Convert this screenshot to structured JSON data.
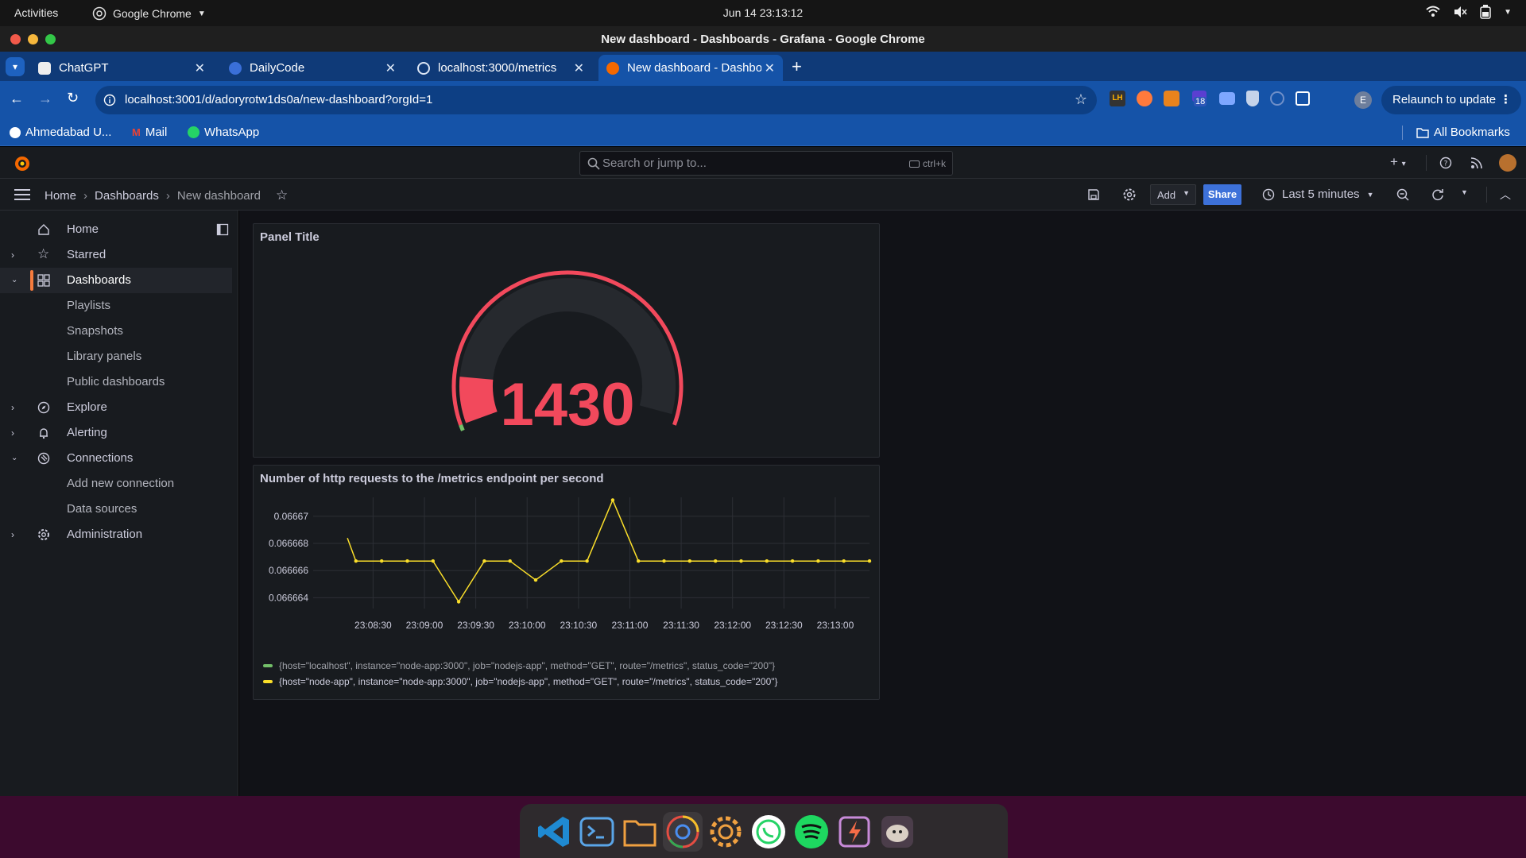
{
  "os": {
    "activities": "Activities",
    "app_name": "Google Chrome",
    "clock": "Jun 14  23:13:12"
  },
  "window": {
    "title": "New dashboard - Dashboards - Grafana - Google Chrome"
  },
  "tabs": [
    {
      "label": "ChatGPT",
      "active": false
    },
    {
      "label": "DailyCode",
      "active": false
    },
    {
      "label": "localhost:3000/metrics",
      "active": false
    },
    {
      "label": "New dashboard - Dashbo",
      "active": true
    }
  ],
  "omnibox": {
    "url": "localhost:3001/d/adoryrotw1ds0a/new-dashboard?orgId=1",
    "relaunch_label": "Relaunch to update",
    "extension_badge": "18",
    "profile_initial": "E"
  },
  "bookmarks": {
    "items": [
      "Ahmedabad U...",
      "Mail",
      "WhatsApp"
    ],
    "all": "All Bookmarks"
  },
  "grafana": {
    "search_placeholder": "Search or jump to...",
    "search_shortcut": "ctrl+k",
    "breadcrumbs": [
      "Home",
      "Dashboards",
      "New dashboard"
    ],
    "toolbar": {
      "add_label": "Add",
      "share_label": "Share",
      "time_range": "Last 5 minutes"
    },
    "nav": {
      "home": "Home",
      "starred": "Starred",
      "dashboards": "Dashboards",
      "playlists": "Playlists",
      "snapshots": "Snapshots",
      "library_panels": "Library panels",
      "public_dashboards": "Public dashboards",
      "explore": "Explore",
      "alerting": "Alerting",
      "connections": "Connections",
      "add_new_connection": "Add new connection",
      "data_sources": "Data sources",
      "administration": "Administration"
    },
    "gauge_panel": {
      "title": "Panel Title",
      "value": "1430",
      "value_color": "#f2495c",
      "fill_fraction": 1.0
    },
    "timeseries_panel": {
      "title": "Number of http requests to the /metrics endpoint per second"
    }
  },
  "chart_data": {
    "type": "line",
    "title": "Number of http requests to the /metrics endpoint per second",
    "x_ticks": [
      "23:08:30",
      "23:09:00",
      "23:09:30",
      "23:10:00",
      "23:10:30",
      "23:11:00",
      "23:11:30",
      "23:12:00",
      "23:12:30",
      "23:13:00"
    ],
    "y_ticks": [
      "0.06667",
      "0.066668",
      "0.066666",
      "0.066664"
    ],
    "ylim": [
      0.0666632,
      0.0666714
    ],
    "series": [
      {
        "name": "{host=\"localhost\", instance=\"node-app:3000\", job=\"nodejs-app\", method=\"GET\", route=\"/metrics\", status_code=\"200\"}",
        "color": "#73bf69",
        "x": [],
        "y": []
      },
      {
        "name": "{host=\"node-app\", instance=\"node-app:3000\", job=\"nodejs-app\", method=\"GET\", route=\"/metrics\", status_code=\"200\"}",
        "color": "#fade2a",
        "x": [
          "23:08:15",
          "23:08:20",
          "23:08:35",
          "23:08:50",
          "23:09:05",
          "23:09:20",
          "23:09:35",
          "23:09:50",
          "23:10:05",
          "23:10:20",
          "23:10:35",
          "23:10:50",
          "23:11:05",
          "23:11:20",
          "23:11:35",
          "23:11:50",
          "23:12:05",
          "23:12:20",
          "23:12:35",
          "23:12:50",
          "23:13:05",
          "23:13:20"
        ],
        "y": [
          0.0666684,
          0.0666667,
          0.0666667,
          0.0666667,
          0.0666667,
          0.0666637,
          0.0666667,
          0.0666667,
          0.0666653,
          0.0666667,
          0.0666667,
          0.0666712,
          0.0666667,
          0.0666667,
          0.0666667,
          0.0666667,
          0.0666667,
          0.0666667,
          0.0666667,
          0.0666667,
          0.0666667,
          0.0666667
        ]
      }
    ],
    "legend": "bottom",
    "grid": true
  }
}
